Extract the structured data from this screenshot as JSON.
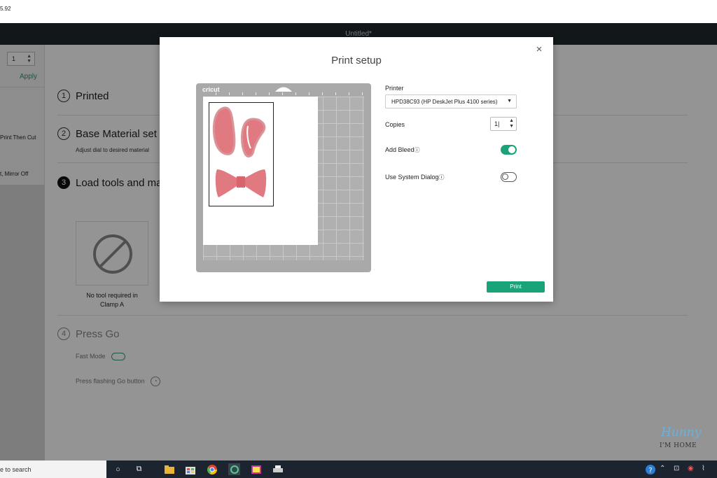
{
  "system": {
    "version_text": "5.92"
  },
  "app": {
    "window_title": "Untitled*",
    "left_panel": {
      "stepper_value": "1",
      "apply_label": "Apply",
      "print_then_cut": "Print Then Cut",
      "mirror_text": "t, Mirror Off"
    },
    "steps": [
      {
        "num": "1",
        "label": "Printed"
      },
      {
        "num": "2",
        "label": "Base Material set t",
        "sub": "Adjust dial to desired material"
      },
      {
        "num": "3",
        "label": "Load tools and ma"
      },
      {
        "num": "4",
        "label": "Press Go"
      }
    ],
    "tool_caption_1": "No tool required in",
    "tool_caption_2": "Clamp A",
    "fast_mode_label": "Fast Mode",
    "press_go_label": "Press flashing Go button"
  },
  "dialog": {
    "title": "Print setup",
    "close_icon": "×",
    "mat_brand": "cricut",
    "printer_label": "Printer",
    "printer_value": "HPD38C93 (HP DeskJet Plus 4100 series)",
    "copies_label": "Copies",
    "copies_value": "1|",
    "add_bleed_label": "Add Bleed",
    "add_bleed_on": true,
    "system_dialog_label": "Use System Dialog",
    "system_dialog_on": false,
    "info_glyph": "ⓘ",
    "print_label": "Print"
  },
  "colors": {
    "accent": "#1aa37a",
    "shape_fill": "#e07a80",
    "shape_outline": "#d9949a"
  },
  "watermark": {
    "line1": "Hunny",
    "line2": "I'M HOME"
  },
  "taskbar": {
    "search_text": "e to search",
    "icons": [
      "cortana-icon",
      "task-view-icon",
      "file-explorer-icon",
      "store-icon",
      "chrome-icon",
      "cricut-icon",
      "photos-icon",
      "printer-app-icon"
    ],
    "tray_icons": [
      "help-icon",
      "chevron-up-icon",
      "network-icon",
      "volume-icon",
      "wifi-icon"
    ]
  }
}
